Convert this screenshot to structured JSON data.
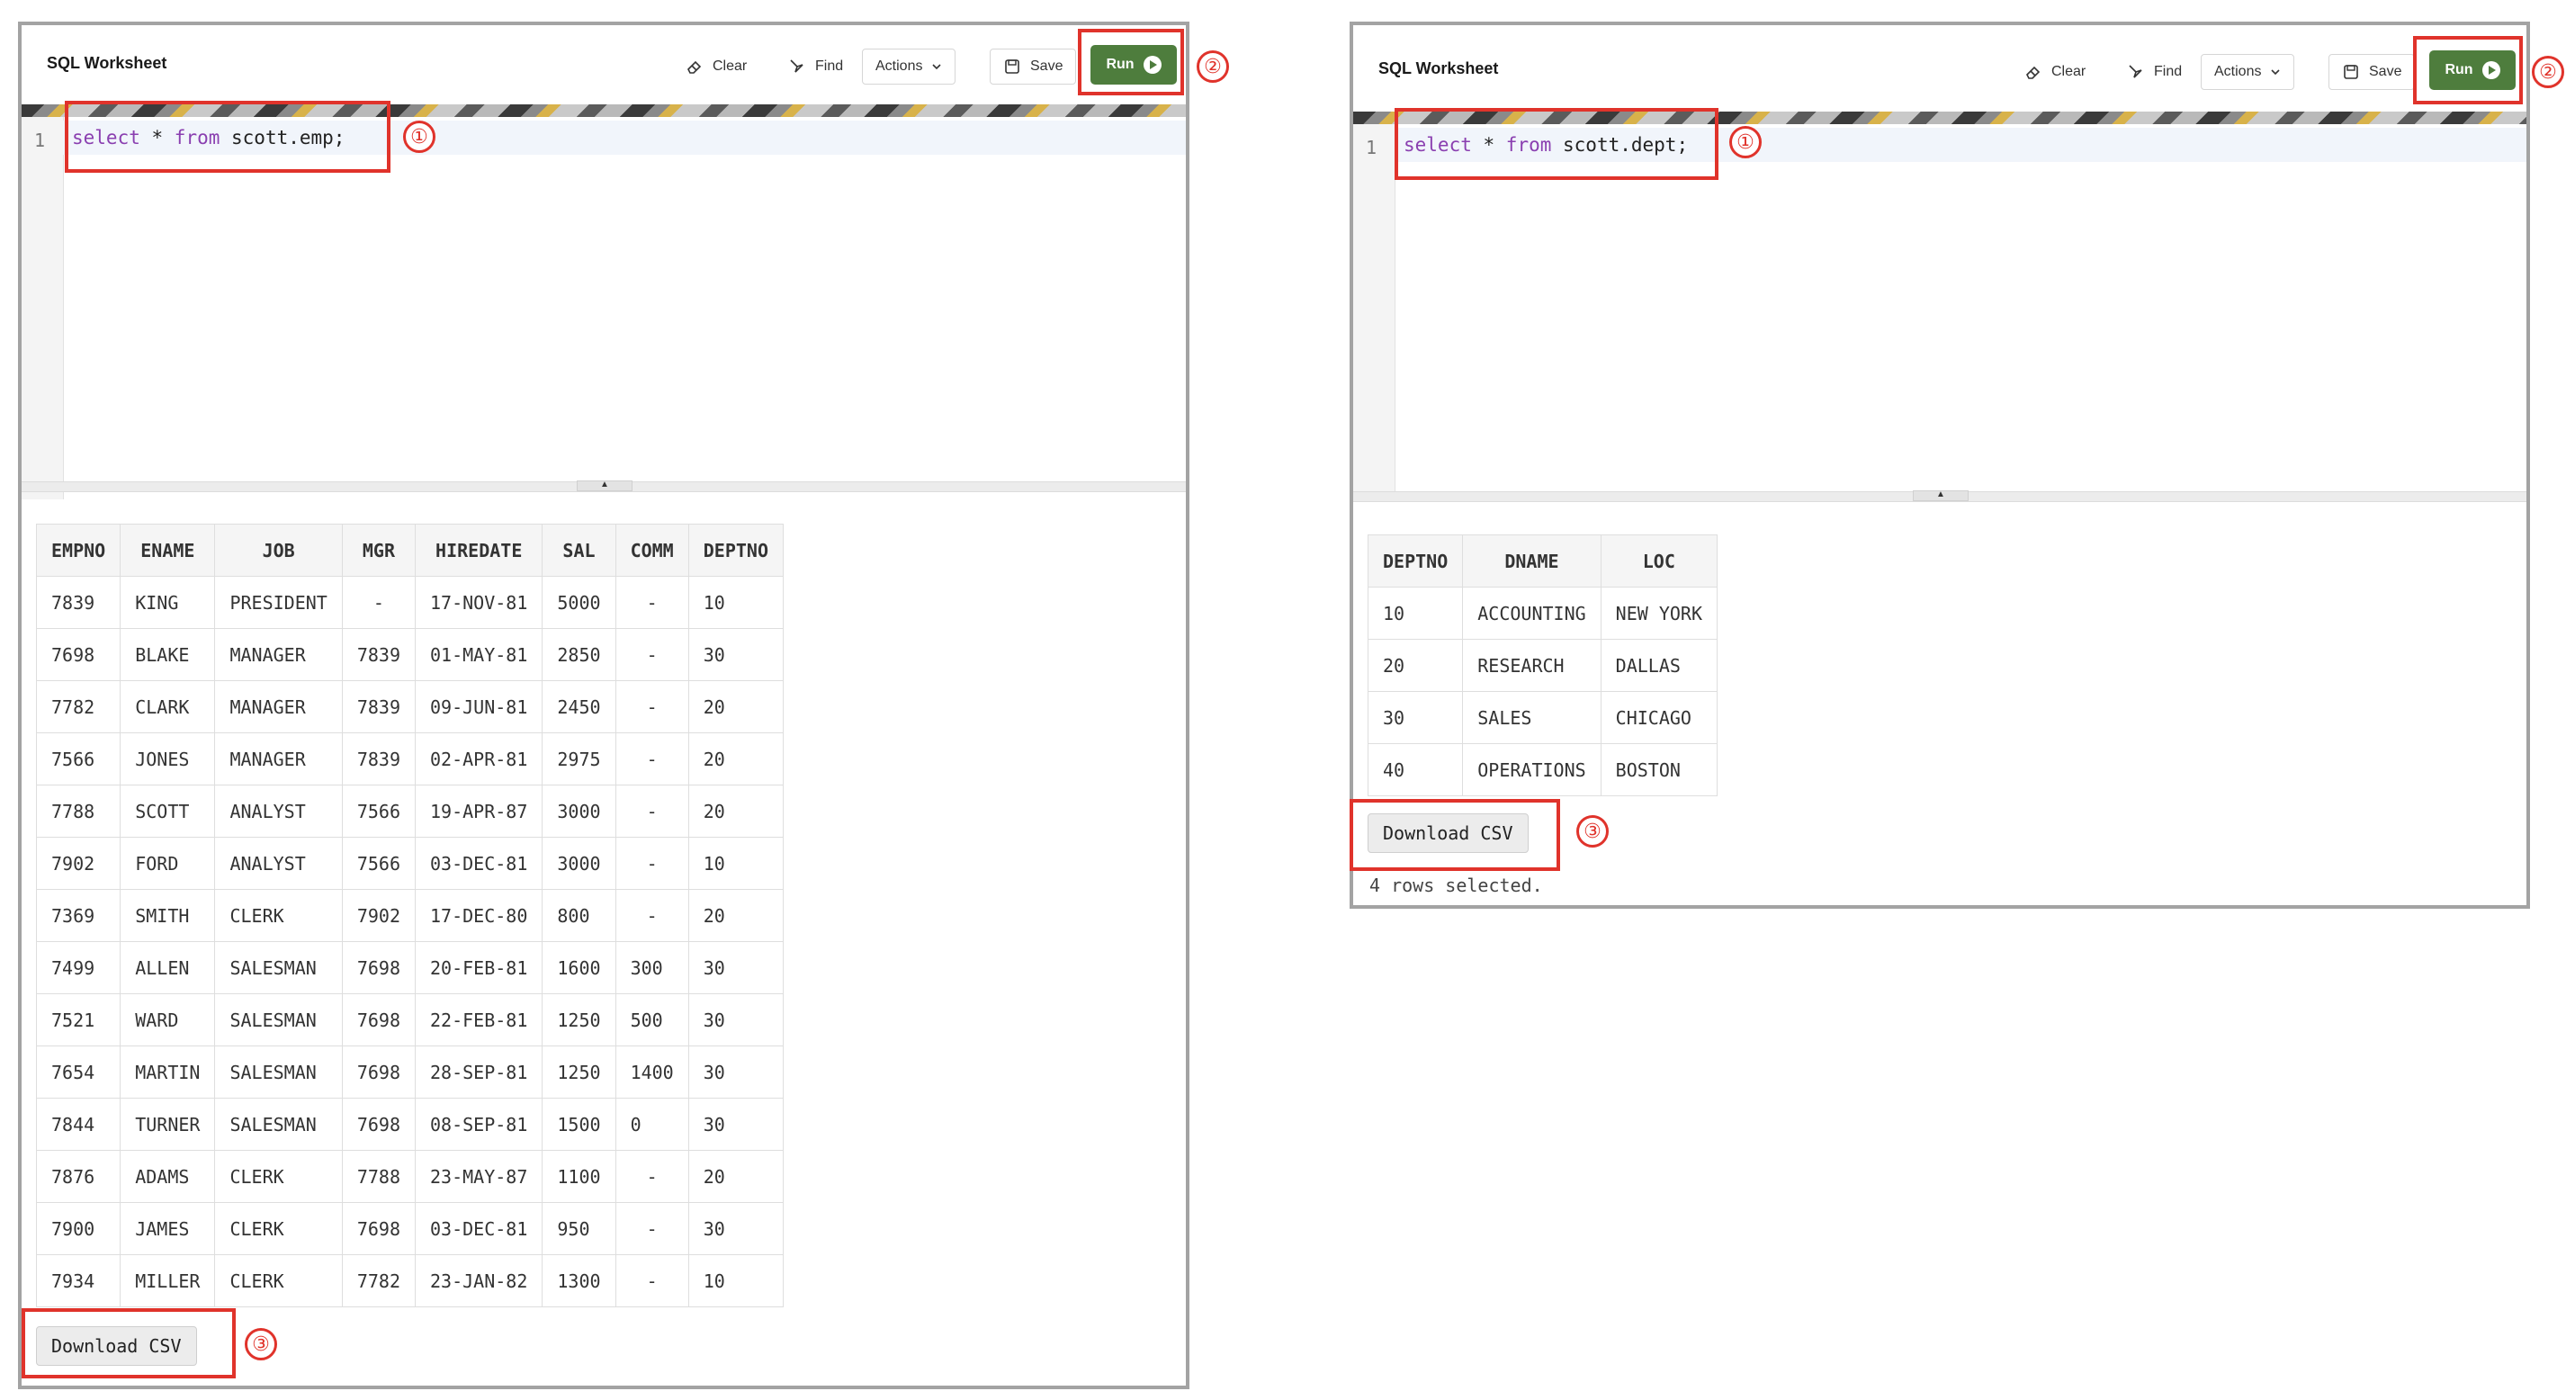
{
  "left": {
    "title": "SQL Worksheet",
    "toolbar": {
      "clear": "Clear",
      "find": "Find",
      "actions": "Actions",
      "save": "Save",
      "run": "Run"
    },
    "line_number": "1",
    "code": {
      "kw1": "select",
      "mid": " * ",
      "kw2": "from",
      "rest": " scott.emp;"
    },
    "columns": [
      "EMPNO",
      "ENAME",
      "JOB",
      "MGR",
      "HIREDATE",
      "SAL",
      "COMM",
      "DEPTNO"
    ],
    "rows": [
      [
        "7839",
        "KING",
        "PRESIDENT",
        "-",
        "17-NOV-81",
        "5000",
        "-",
        "10"
      ],
      [
        "7698",
        "BLAKE",
        "MANAGER",
        "7839",
        "01-MAY-81",
        "2850",
        "-",
        "30"
      ],
      [
        "7782",
        "CLARK",
        "MANAGER",
        "7839",
        "09-JUN-81",
        "2450",
        "-",
        "20"
      ],
      [
        "7566",
        "JONES",
        "MANAGER",
        "7839",
        "02-APR-81",
        "2975",
        "-",
        "20"
      ],
      [
        "7788",
        "SCOTT",
        "ANALYST",
        "7566",
        "19-APR-87",
        "3000",
        "-",
        "20"
      ],
      [
        "7902",
        "FORD",
        "ANALYST",
        "7566",
        "03-DEC-81",
        "3000",
        "-",
        "10"
      ],
      [
        "7369",
        "SMITH",
        "CLERK",
        "7902",
        "17-DEC-80",
        "800",
        "-",
        "20"
      ],
      [
        "7499",
        "ALLEN",
        "SALESMAN",
        "7698",
        "20-FEB-81",
        "1600",
        "300",
        "30"
      ],
      [
        "7521",
        "WARD",
        "SALESMAN",
        "7698",
        "22-FEB-81",
        "1250",
        "500",
        "30"
      ],
      [
        "7654",
        "MARTIN",
        "SALESMAN",
        "7698",
        "28-SEP-81",
        "1250",
        "1400",
        "30"
      ],
      [
        "7844",
        "TURNER",
        "SALESMAN",
        "7698",
        "08-SEP-81",
        "1500",
        "0",
        "30"
      ],
      [
        "7876",
        "ADAMS",
        "CLERK",
        "7788",
        "23-MAY-87",
        "1100",
        "-",
        "20"
      ],
      [
        "7900",
        "JAMES",
        "CLERK",
        "7698",
        "03-DEC-81",
        "950",
        "-",
        "30"
      ],
      [
        "7934",
        "MILLER",
        "CLERK",
        "7782",
        "23-JAN-82",
        "1300",
        "-",
        "10"
      ]
    ],
    "download": "Download CSV"
  },
  "right": {
    "title": "SQL Worksheet",
    "toolbar": {
      "clear": "Clear",
      "find": "Find",
      "actions": "Actions",
      "save": "Save",
      "run": "Run"
    },
    "line_number": "1",
    "code": {
      "kw1": "select",
      "mid": " * ",
      "kw2": "from",
      "rest": " scott.dept;"
    },
    "columns": [
      "DEPTNO",
      "DNAME",
      "LOC"
    ],
    "rows": [
      [
        "10",
        "ACCOUNTING",
        "NEW YORK"
      ],
      [
        "20",
        "RESEARCH",
        "DALLAS"
      ],
      [
        "30",
        "SALES",
        "CHICAGO"
      ],
      [
        "40",
        "OPERATIONS",
        "BOSTON"
      ]
    ],
    "download": "Download CSV",
    "rows_message": "4 rows selected."
  },
  "markers": {
    "one": "①",
    "two": "②",
    "three": "③"
  },
  "colors": {
    "run_green": "#4e7d3d",
    "callout_red": "#e0332b"
  }
}
